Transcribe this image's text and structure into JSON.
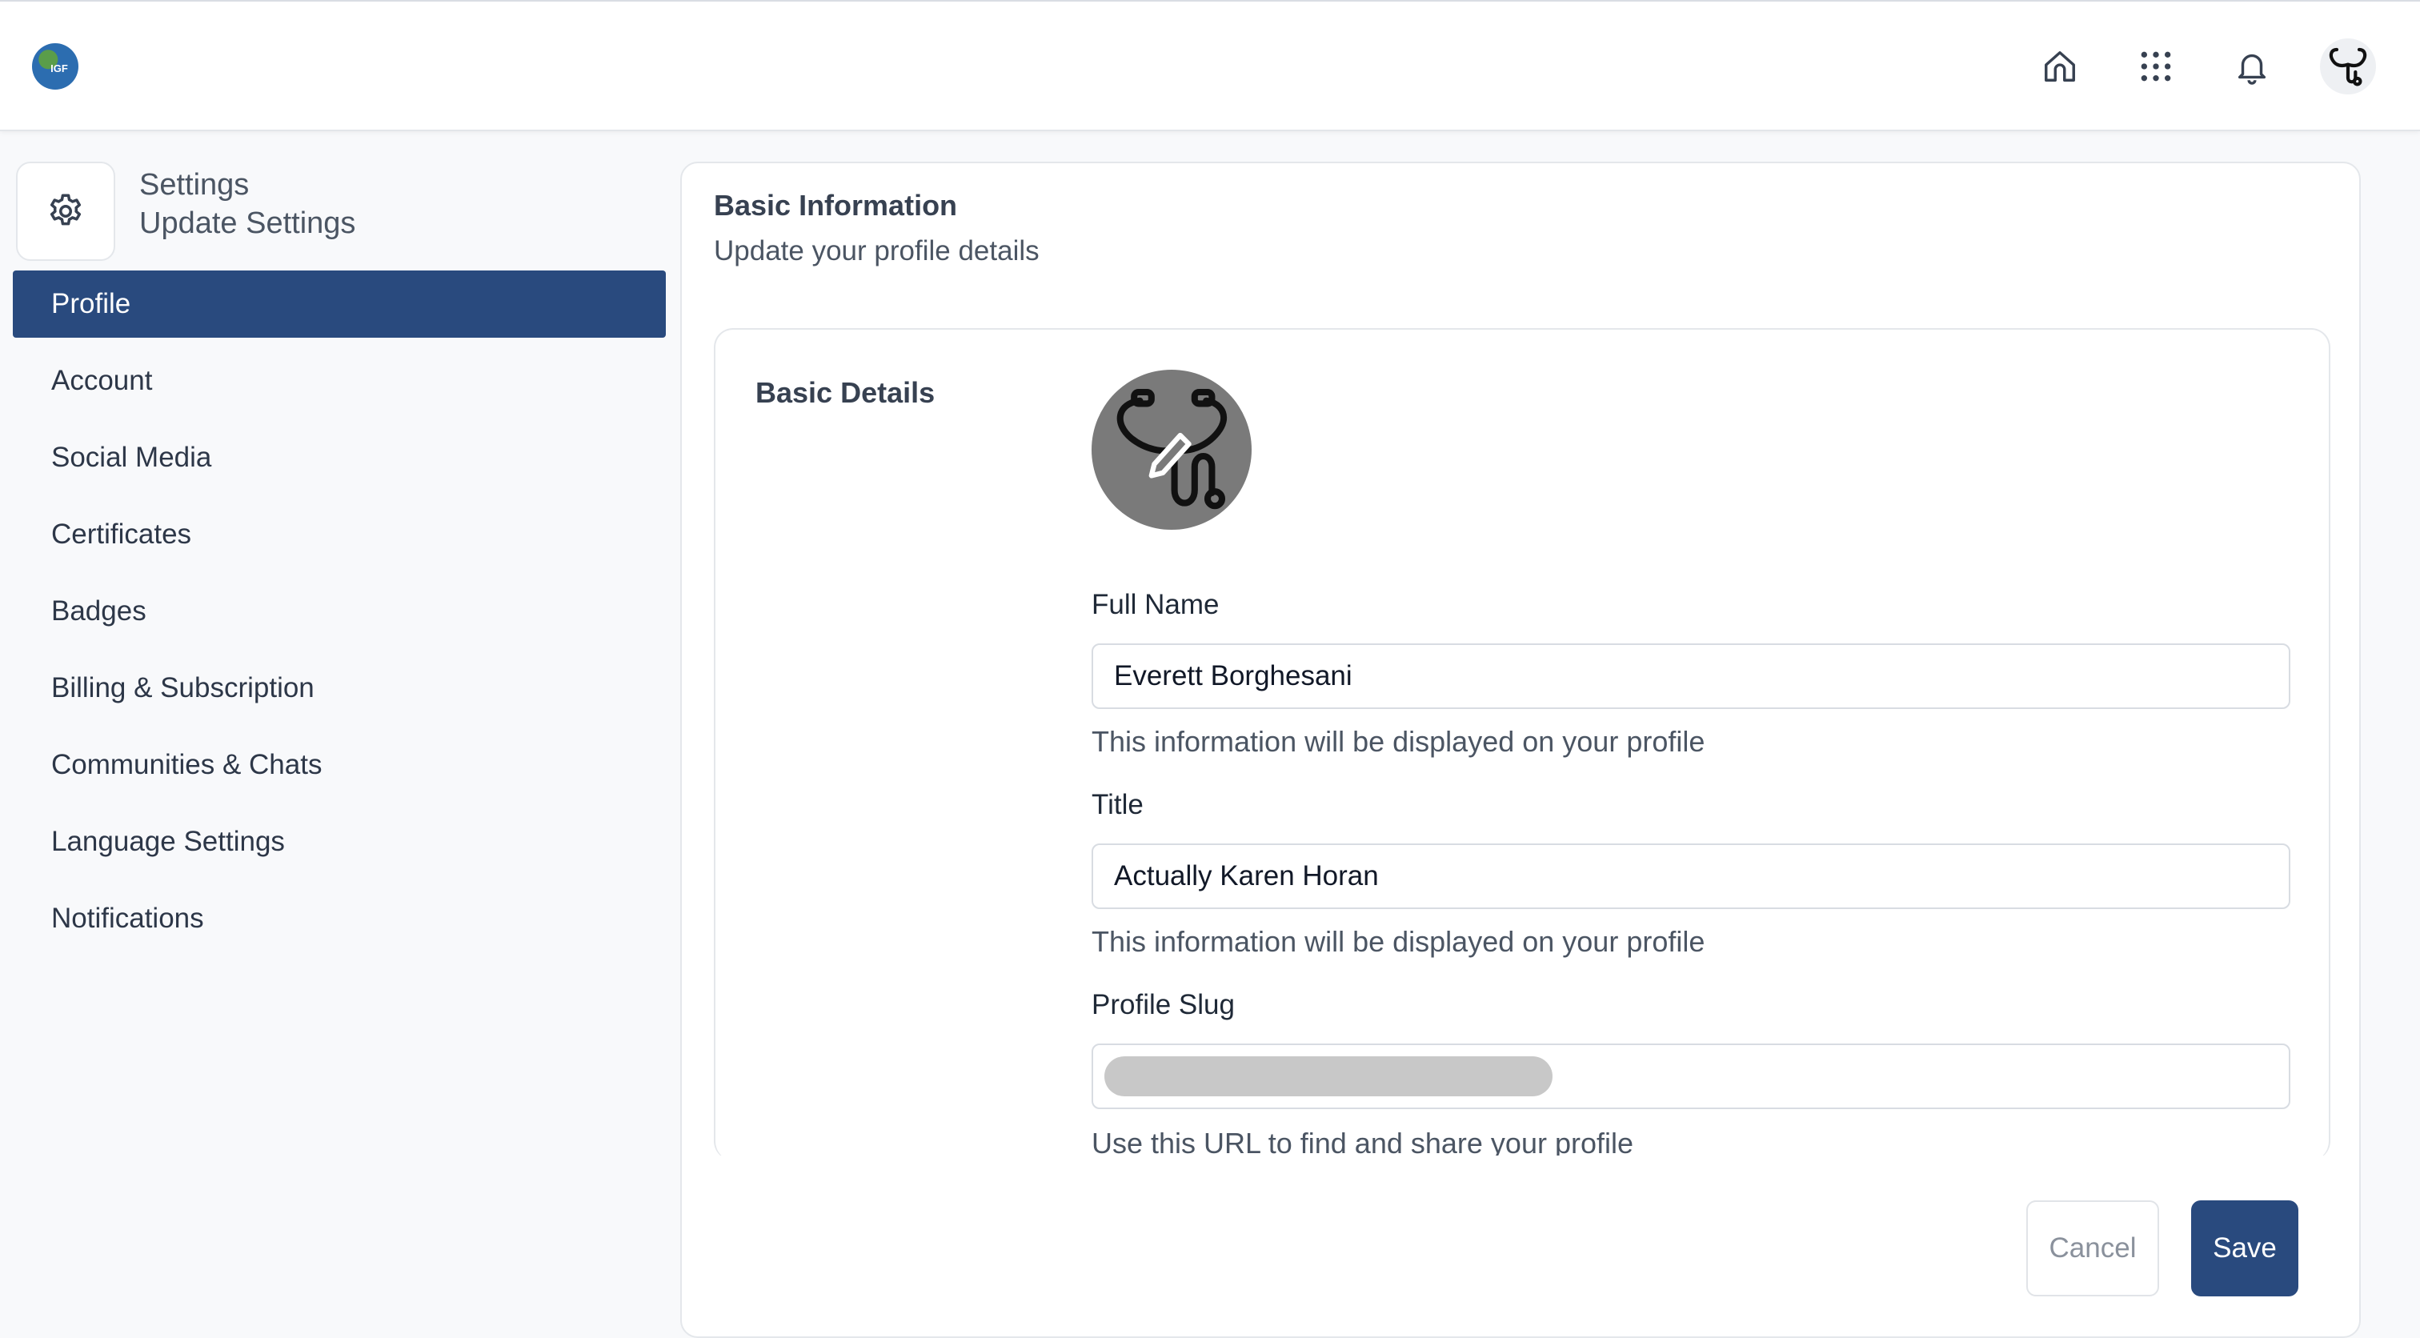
{
  "app": {
    "logo_text": "IGF"
  },
  "topbar": {
    "icons": [
      "home-icon",
      "apps-grid-icon",
      "bell-icon",
      "stethoscope-avatar"
    ]
  },
  "sidebar": {
    "title": "Settings",
    "subtitle": "Update Settings",
    "items": [
      {
        "label": "Profile",
        "active": true
      },
      {
        "label": "Account",
        "active": false
      },
      {
        "label": "Social Media",
        "active": false
      },
      {
        "label": "Certificates",
        "active": false
      },
      {
        "label": "Badges",
        "active": false
      },
      {
        "label": "Billing & Subscription",
        "active": false
      },
      {
        "label": "Communities & Chats",
        "active": false
      },
      {
        "label": "Language Settings",
        "active": false
      },
      {
        "label": "Notifications",
        "active": false
      }
    ]
  },
  "main": {
    "title": "Basic Information",
    "subtitle": "Update your profile details",
    "section_title": "Basic Details",
    "full_name": {
      "label": "Full Name",
      "value": "Everett Borghesani",
      "help": "This information will be displayed on your profile"
    },
    "title_field": {
      "label": "Title",
      "value": "Actually Karen Horan",
      "help": "This information will be displayed on your profile"
    },
    "slug": {
      "label": "Profile Slug",
      "value": "",
      "help": "Use this URL to find and share your profile"
    },
    "cancel_label": "Cancel",
    "save_label": "Save"
  },
  "colors": {
    "primary": "#294a7e",
    "avatar_bg": "#7a7a7a",
    "border": "#e4e7eb"
  }
}
